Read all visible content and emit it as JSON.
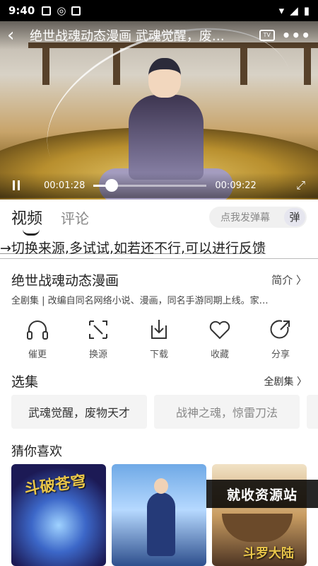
{
  "status_bar": {
    "time": "9:40"
  },
  "player": {
    "title": "绝世战魂动态漫画 武魂觉醒，废…",
    "tv_label": "TV",
    "current_time": "00:01:28",
    "total_time": "00:09:22",
    "progress_fraction": 0.157
  },
  "tabs": [
    {
      "label": "视频"
    },
    {
      "label": "评论"
    }
  ],
  "danmaku": {
    "placeholder": "点我发弹幕",
    "button": "弹"
  },
  "notice": "→切换来源,多试试,如若还不行,可以进行反馈",
  "show": {
    "title": "绝世战魂动态漫画",
    "intro_link": "简介 〉",
    "description": "全剧集 | 改编自同名网络小说、漫画，同名手游同期上线。家…"
  },
  "actions": [
    {
      "label": "催更",
      "icon": "headphones-icon"
    },
    {
      "label": "换源",
      "icon": "switch-source-icon"
    },
    {
      "label": "下载",
      "icon": "download-icon"
    },
    {
      "label": "收藏",
      "icon": "heart-icon"
    },
    {
      "label": "分享",
      "icon": "share-icon"
    }
  ],
  "episodes": {
    "heading": "选集",
    "all_link": "全剧集 〉",
    "items": [
      "武魂觉醒，废物天才",
      "战神之魂，惊雷刀法"
    ]
  },
  "recommend": {
    "heading": "猜你喜欢",
    "posters": [
      {
        "art": "斗破苍穹"
      },
      {
        "art": ""
      },
      {
        "art": "斗罗大陆"
      }
    ]
  },
  "watermark": "就收资源站",
  "colors": {
    "accent": "#e03c3c",
    "text": "#222222",
    "chip_bg": "#f4f4f4"
  }
}
